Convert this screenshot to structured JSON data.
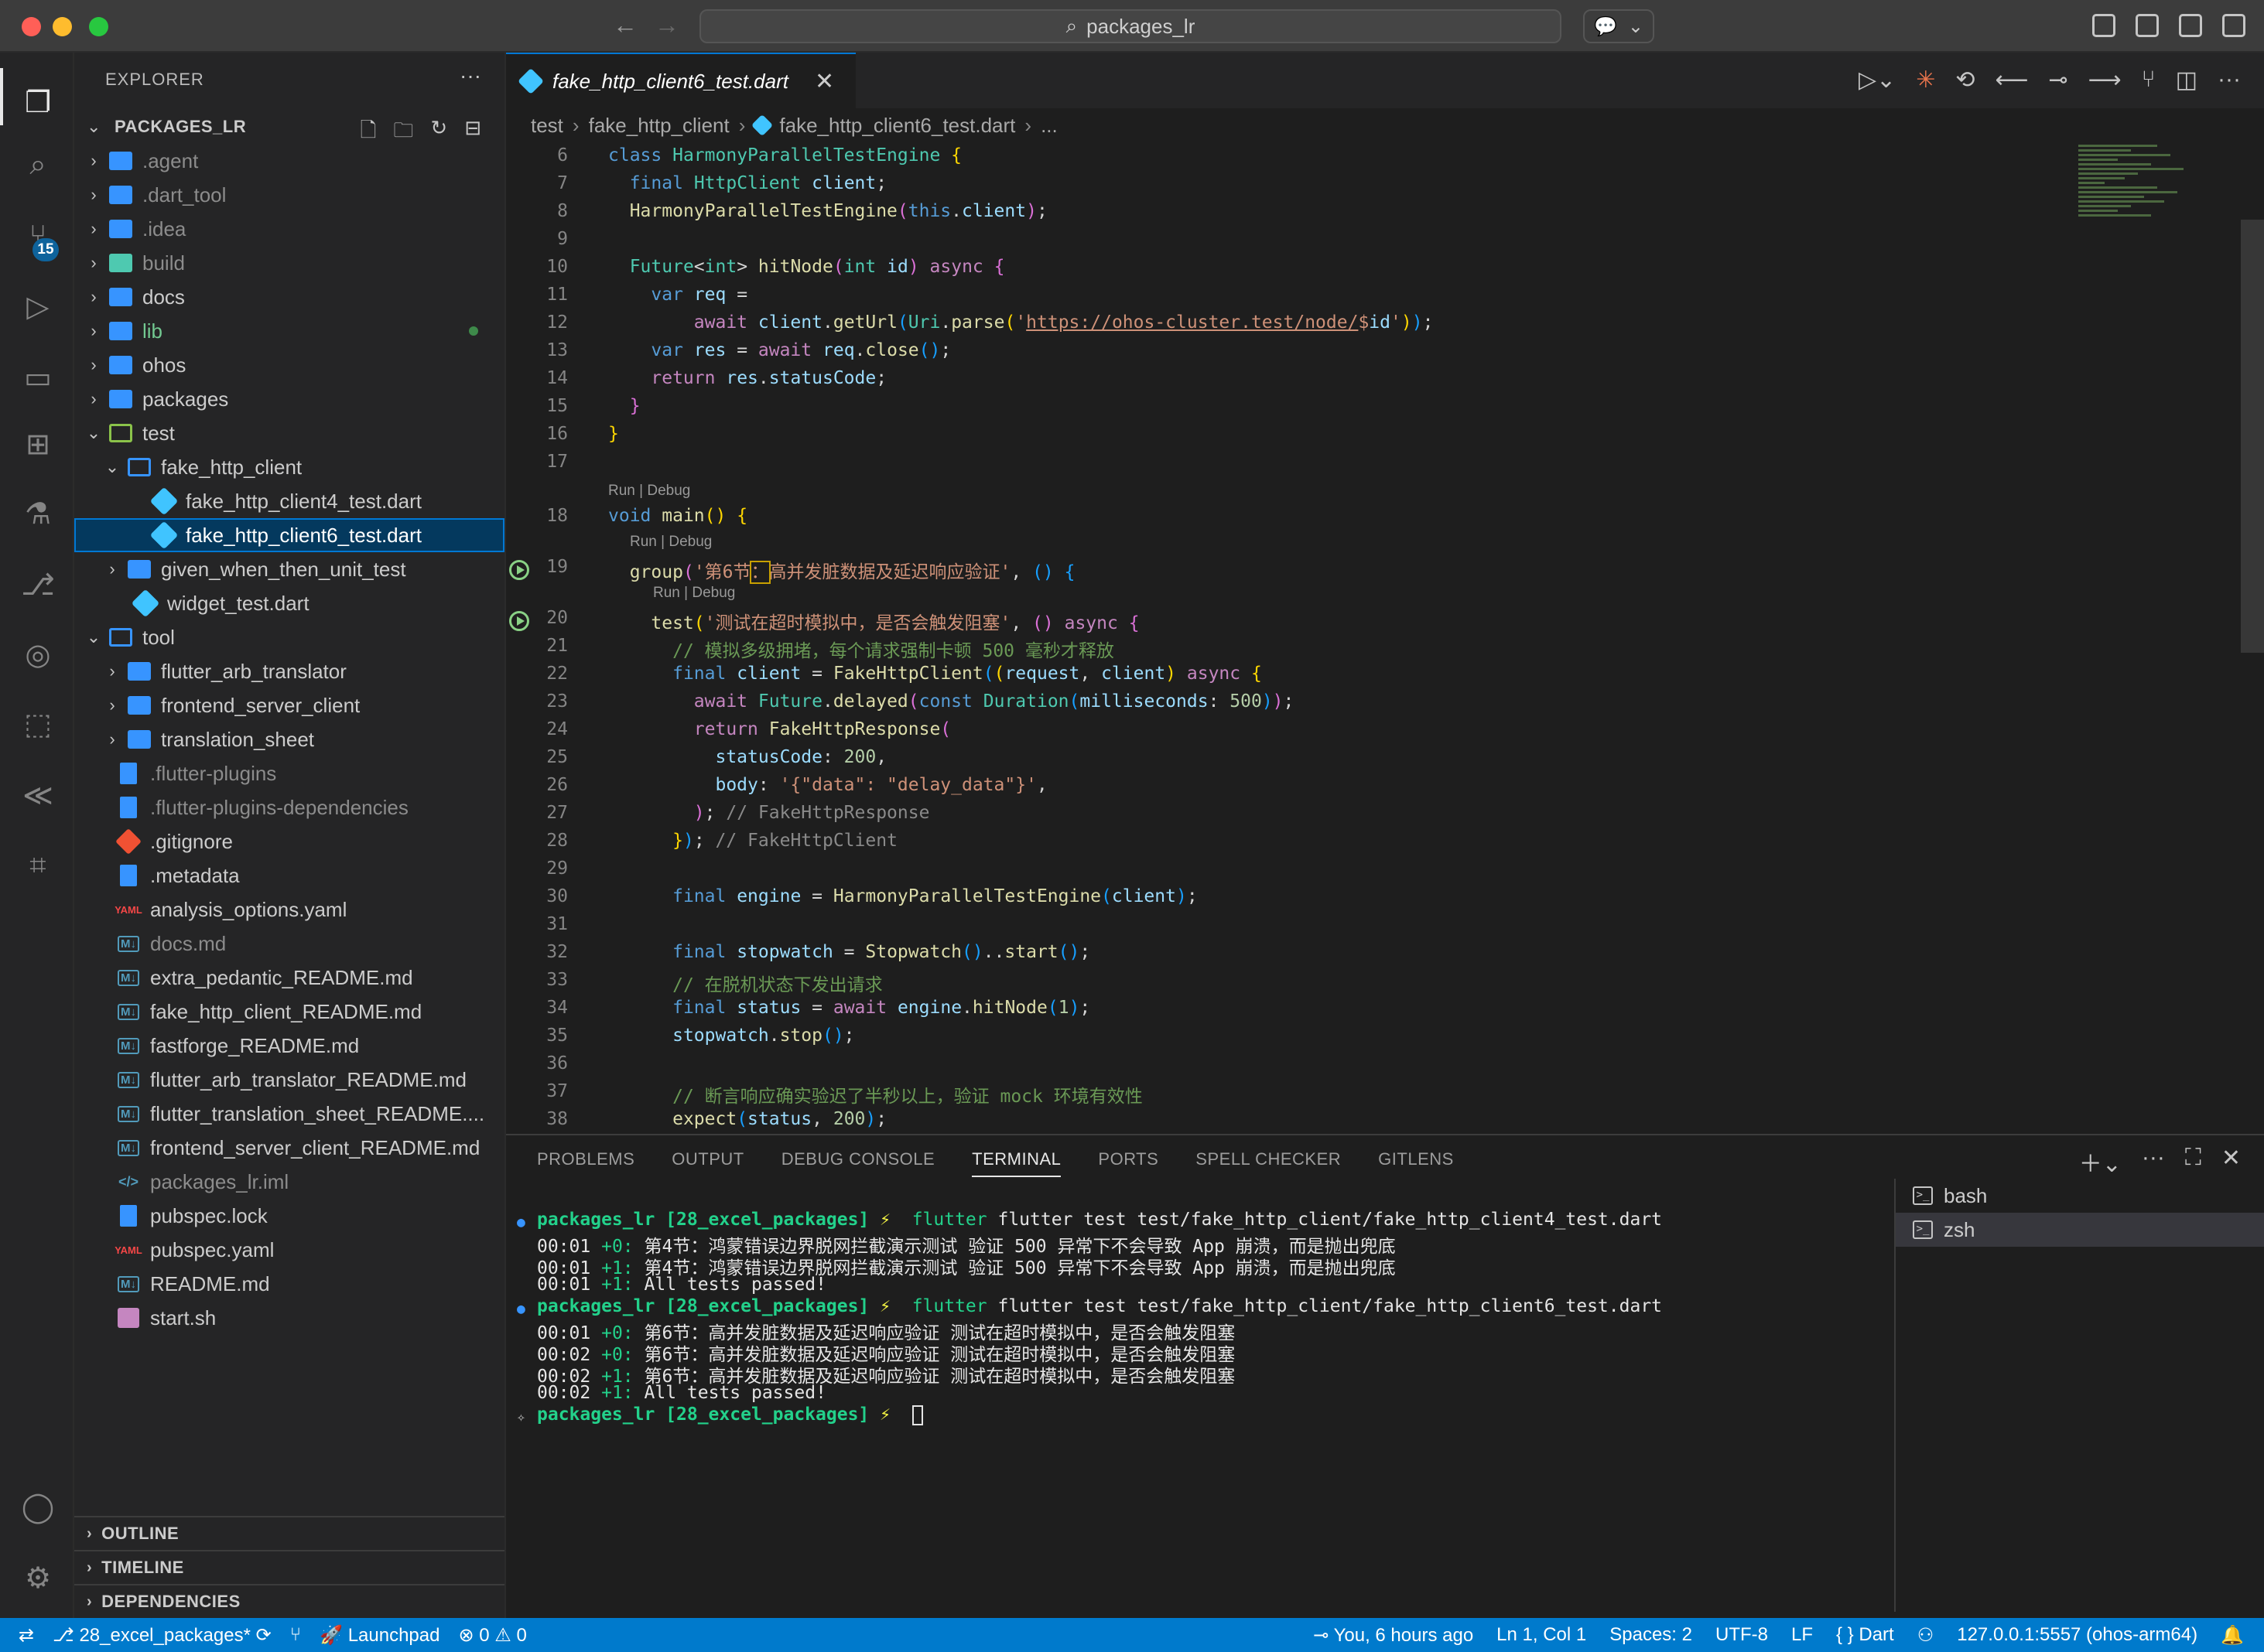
{
  "titlebar": {
    "search": "packages_lr"
  },
  "activity": {
    "scm_badge": "15"
  },
  "explorer": {
    "title": "EXPLORER",
    "project": "PACKAGES_LR",
    "items": [
      {
        "label": "agent_dot",
        "text": ".agent"
      },
      {
        "text": ".dart_tool"
      },
      {
        "text": ".idea"
      },
      {
        "text": "build"
      },
      {
        "text": "docs"
      },
      {
        "text": "lib"
      },
      {
        "text": "ohos"
      },
      {
        "text": "packages"
      },
      {
        "text": "test"
      },
      {
        "text": "fake_http_client"
      },
      {
        "text": "fake_http_client4_test.dart"
      },
      {
        "text": "fake_http_client6_test.dart"
      },
      {
        "text": "given_when_then_unit_test"
      },
      {
        "text": "widget_test.dart"
      },
      {
        "text": "tool"
      },
      {
        "text": "flutter_arb_translator"
      },
      {
        "text": "frontend_server_client"
      },
      {
        "text": "translation_sheet"
      },
      {
        "text": ".flutter-plugins"
      },
      {
        "text": ".flutter-plugins-dependencies"
      },
      {
        "text": ".gitignore"
      },
      {
        "text": ".metadata"
      },
      {
        "text": "analysis_options.yaml"
      },
      {
        "text": "docs.md"
      },
      {
        "text": "extra_pedantic_README.md"
      },
      {
        "text": "fake_http_client_README.md"
      },
      {
        "text": "fastforge_README.md"
      },
      {
        "text": "flutter_arb_translator_README.md"
      },
      {
        "text": "flutter_translation_sheet_README...."
      },
      {
        "text": "frontend_server_client_README.md"
      },
      {
        "text": "packages_lr.iml"
      },
      {
        "text": "pubspec.lock"
      },
      {
        "text": "pubspec.yaml"
      },
      {
        "text": "README.md"
      },
      {
        "text": "start.sh"
      }
    ],
    "sections": [
      "OUTLINE",
      "TIMELINE",
      "DEPENDENCIES"
    ]
  },
  "editor": {
    "tab": "fake_http_client6_test.dart",
    "breadcrumb": [
      "test",
      "fake_http_client",
      "fake_http_client6_test.dart",
      "..."
    ],
    "codelens": "Run | Debug",
    "line_numbers": [
      "6",
      "7",
      "8",
      "9",
      "10",
      "11",
      "12",
      "13",
      "14",
      "15",
      "16",
      "17",
      "18",
      "19",
      "20",
      "21",
      "22",
      "23",
      "24",
      "25",
      "26",
      "27",
      "28",
      "29",
      "30",
      "31",
      "32",
      "33",
      "34",
      "35",
      "36",
      "37",
      "38"
    ]
  },
  "panel": {
    "tabs": [
      "PROBLEMS",
      "OUTPUT",
      "DEBUG CONSOLE",
      "TERMINAL",
      "PORTS",
      "SPELL CHECKER",
      "GITLENS"
    ],
    "active_tab": "TERMINAL",
    "terminals": [
      "bash",
      "zsh"
    ],
    "prompt": "packages_lr [28_excel_packages]",
    "cmd1": "flutter test test/fake_http_client/fake_http_client4_test.dart",
    "cmd2": "flutter test test/fake_http_client/fake_http_client6_test.dart",
    "out": [
      {
        "t": "00:01",
        "c": "+0:",
        "msg": "第4节：鸿蒙错误边界脱网拦截演示测试 验证 500 异常下不会导致 App 崩溃，而是抛出兜底"
      },
      {
        "t": "00:01",
        "c": "+1:",
        "msg": "第4节：鸿蒙错误边界脱网拦截演示测试 验证 500 异常下不会导致 App 崩溃，而是抛出兜底"
      },
      {
        "t": "00:01",
        "c": "+1:",
        "msg": "All tests passed!"
      },
      {
        "t": "00:01",
        "c": "+0:",
        "msg": "第6节：高并发脏数据及延迟响应验证 测试在超时模拟中，是否会触发阻塞"
      },
      {
        "t": "00:02",
        "c": "+0:",
        "msg": "第6节：高并发脏数据及延迟响应验证 测试在超时模拟中，是否会触发阻塞"
      },
      {
        "t": "00:02",
        "c": "+1:",
        "msg": "第6节：高并发脏数据及延迟响应验证 测试在超时模拟中，是否会触发阻塞"
      },
      {
        "t": "00:02",
        "c": "+1:",
        "msg": "All tests passed!"
      }
    ]
  },
  "statusbar": {
    "branch": "28_excel_packages*",
    "launchpad": "Launchpad",
    "errors": "0",
    "warnings": "0",
    "blame": "You, 6 hours ago",
    "position": "Ln 1, Col 1",
    "spaces": "Spaces: 2",
    "encoding": "UTF-8",
    "eol": "LF",
    "language": "Dart",
    "device": "127.0.0.1:5557 (ohos-arm64)"
  }
}
